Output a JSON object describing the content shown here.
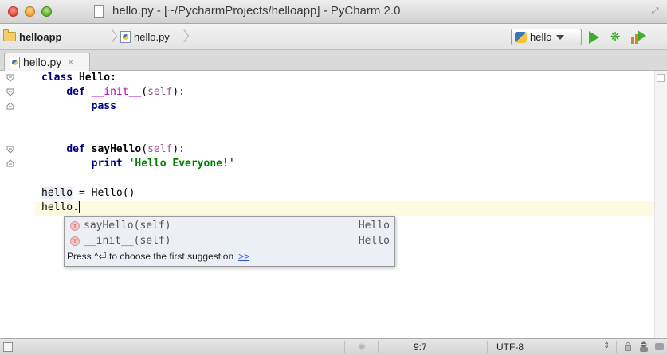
{
  "window": {
    "title": "hello.py - [~/PycharmProjects/helloapp] - PyCharm 2.0"
  },
  "navbar": {
    "project": "helloapp",
    "file": "hello.py",
    "run_config": "hello"
  },
  "tabs": [
    {
      "label": "hello.py",
      "close": "×"
    }
  ],
  "editor": {
    "lines": [
      {
        "id": "l1",
        "text": "class Hello:"
      },
      {
        "id": "l2",
        "text": "def __init__(self):"
      },
      {
        "id": "l3",
        "text": "pass"
      },
      {
        "id": "l5",
        "text": "def sayHello(self):"
      },
      {
        "id": "l6",
        "text": "print 'Hello Everyone!'"
      },
      {
        "id": "l8",
        "text": "hello = Hello()"
      },
      {
        "id": "l9",
        "text": "hello."
      }
    ],
    "tokens": {
      "class_kw": "class",
      "class_name": "Hello:",
      "def_kw": "def",
      "init_name": "__init__",
      "self_kw": "self",
      "pass_kw": "pass",
      "say_name": "sayHello",
      "print_kw": "print",
      "string": "'Hello Everyone!'",
      "hello_var": "hello",
      "assign_rest": " = Hello()",
      "dot": "."
    }
  },
  "autocomplete": {
    "items": [
      {
        "icon": "m",
        "name": "sayHello(self)",
        "type": "Hello"
      },
      {
        "icon": "m",
        "name": "__init__(self)",
        "type": "Hello"
      }
    ],
    "hint": "Press ^⏎ to choose the first suggestion",
    "more_link": ">>"
  },
  "statusbar": {
    "position": "9:7",
    "encoding": "UTF-8"
  },
  "colors": {
    "keyword": "#000080",
    "self": "#94558d",
    "magic": "#b200b2",
    "string": "#008000",
    "current_line": "#fdfae2",
    "popup_bg": "#eceff6",
    "run_green": "#3cae2a"
  },
  "icons": [
    "folder-icon",
    "python-file-icon",
    "run-icon",
    "debug-icon",
    "coverage-icon",
    "method-icon",
    "fold-icon",
    "lock-icon",
    "inspector-icon",
    "message-icon"
  ]
}
